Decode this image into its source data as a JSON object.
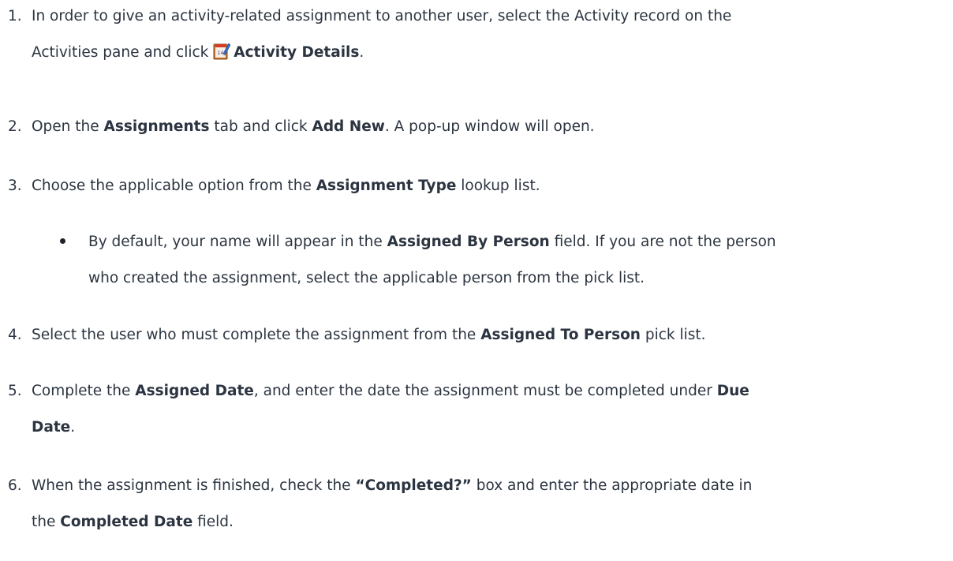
{
  "steps": [
    {
      "num": "1.",
      "lines": [
        [
          "In order to give an activity-related assignment to another user, select the Activity record on the"
        ],
        [
          "Activities pane and click ",
          {
            "icon": "activity-details-icon"
          },
          {
            "b": "Activity Details"
          },
          "."
        ]
      ]
    },
    {
      "num": "2.",
      "lines": [
        [
          "Open the ",
          {
            "b": "Assignments"
          },
          " tab and click ",
          {
            "b": "Add New"
          },
          ". A pop-up window will open."
        ]
      ]
    },
    {
      "num": "3.",
      "lines": [
        [
          "Choose the applicable option from the ",
          {
            "b": "Assignment Type"
          },
          " lookup list."
        ]
      ]
    },
    {
      "bullet": true,
      "lines": [
        [
          "By default, your name will appear in the ",
          {
            "b": "Assigned By Person"
          },
          " field. If you are not the person"
        ],
        [
          "who created the assignment, select the applicable person from the pick list."
        ]
      ]
    },
    {
      "num": "4.",
      "lines": [
        [
          "Select the user who must complete the assignment from the ",
          {
            "b": "Assigned To Person"
          },
          " pick list."
        ]
      ]
    },
    {
      "num": "5.",
      "lines": [
        [
          "Complete the ",
          {
            "b": "Assigned Date"
          },
          ", and enter the date the assignment must be completed under ",
          {
            "b": "Due"
          }
        ],
        [
          {
            "b": "Date"
          },
          "."
        ]
      ]
    },
    {
      "num": "6.",
      "lines": [
        [
          "When the assignment is finished, check the ",
          {
            "b": "“Completed?”"
          },
          " box and enter the appropriate date in"
        ],
        [
          "the ",
          {
            "b": "Completed Date"
          },
          " field."
        ]
      ]
    }
  ]
}
